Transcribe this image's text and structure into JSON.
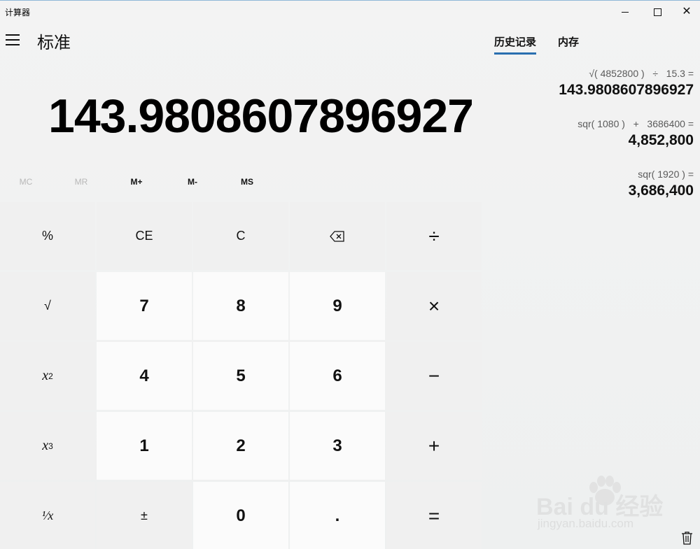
{
  "app": {
    "title": "计算器"
  },
  "window_controls": {
    "minimize": "—",
    "maximize": "☐",
    "close": "✕"
  },
  "header": {
    "menu_icon": "hamburger-icon",
    "mode_title": "标准"
  },
  "display": {
    "value": "143.9808607896927"
  },
  "memory": {
    "buttons": [
      {
        "label": "MC",
        "enabled": false
      },
      {
        "label": "MR",
        "enabled": false
      },
      {
        "label": "M+",
        "enabled": true
      },
      {
        "label": "M-",
        "enabled": true
      },
      {
        "label": "MS",
        "enabled": true
      }
    ]
  },
  "keypad": {
    "percent": "%",
    "ce": "CE",
    "c": "C",
    "backspace_icon": "backspace-icon",
    "divide": "÷",
    "sqrt": "√",
    "n7": "7",
    "n8": "8",
    "n9": "9",
    "multiply": "×",
    "square_base": "x",
    "square_exp": "2",
    "n4": "4",
    "n5": "5",
    "n6": "6",
    "subtract": "−",
    "cube_base": "x",
    "cube_exp": "3",
    "n1": "1",
    "n2": "2",
    "n3": "3",
    "add": "+",
    "reciprocal": "¹⁄x",
    "negate": "±",
    "n0": "0",
    "decimal": ".",
    "equals": "="
  },
  "side_panel": {
    "tabs": [
      {
        "label": "历史记录",
        "active": true
      },
      {
        "label": "内存",
        "active": false
      }
    ],
    "history": [
      {
        "expression": "√( 4852800 )   ÷   15.3 =",
        "result": "143.9808607896927"
      },
      {
        "expression": "sqr( 1080 )   +   3686400 =",
        "result": "4,852,800"
      },
      {
        "expression": "sqr( 1920 ) =",
        "result": "3,686,400"
      }
    ],
    "trash_icon": "trash-icon"
  },
  "watermark": {
    "brand": "Bai du 经验",
    "url": "jingyan.baidu.com"
  },
  "colors": {
    "accent": "#2a6fb0",
    "number_key_bg": "#fbfbfb",
    "function_key_bg": "#f0f0f0"
  }
}
